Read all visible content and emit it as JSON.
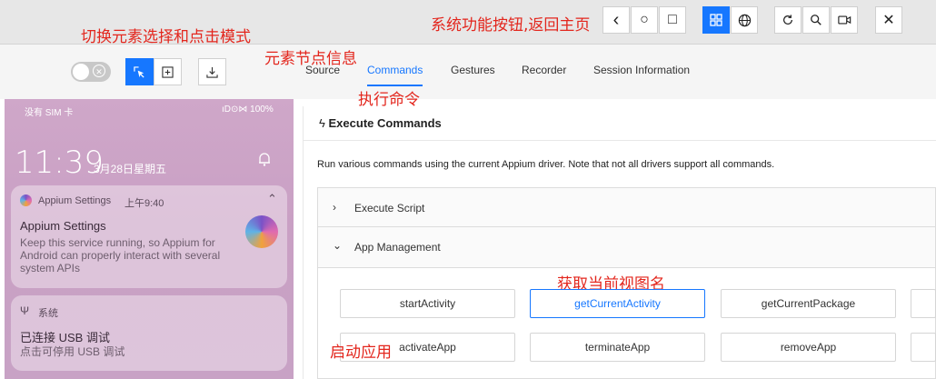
{
  "annotations": {
    "mode_switch": "切换元素选择和点击模式",
    "system_buttons": "系统功能按钮,返回主页",
    "node_info": "元素节点信息",
    "execute_command": "执行命令",
    "get_current_view": "获取当前视图名",
    "launch_app": "启动应用"
  },
  "topbar": {
    "back_glyph": "‹",
    "home_glyph": "○",
    "recent_glyph": "□",
    "close_glyph": "✕"
  },
  "tabs": [
    "Source",
    "Commands",
    "Gestures",
    "Recorder",
    "Session Information"
  ],
  "active_tab": "Commands",
  "phone": {
    "carrier": "没有 SIM 卡",
    "status_icons": "ıD⊙⋈ 100%",
    "time": "11:39",
    "date": "3月28日星期五",
    "notification1": {
      "app": "Appium Settings",
      "time": "上午9:40",
      "title": "Appium Settings",
      "body": "Keep this service running, so Appium for Android can properly interact with several system APIs"
    },
    "notification2": {
      "app": "系统",
      "title": "已连接 USB 调试",
      "body": "点击可停用 USB 调试"
    }
  },
  "commands_panel": {
    "title": "Execute Commands",
    "description": "Run various commands using the current Appium driver. Note that not all drivers support all commands.",
    "sections": [
      {
        "label": "Execute Script",
        "expanded": false
      },
      {
        "label": "App Management",
        "expanded": true
      }
    ],
    "buttons": [
      [
        "startActivity",
        "getCurrentActivity",
        "getCurrentPackage"
      ],
      [
        "activateApp",
        "terminateApp",
        "removeApp"
      ]
    ],
    "selected_button": "getCurrentActivity"
  },
  "colors": {
    "accent": "#1677ff",
    "annotation": "#e3261d"
  }
}
